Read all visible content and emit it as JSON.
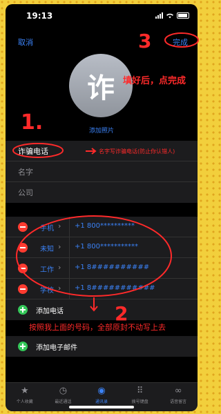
{
  "status": {
    "time": "19:13"
  },
  "nav": {
    "cancel": "取消",
    "done": "完成"
  },
  "avatar": {
    "initial": "诈",
    "add_photo": "添加照片"
  },
  "name_fields": [
    {
      "value": "诈骗电话",
      "placeholder": false
    },
    {
      "value": "名字",
      "placeholder": true
    },
    {
      "value": "公司",
      "placeholder": true
    }
  ],
  "phones": [
    {
      "type": "手机",
      "number": "+1 800**********"
    },
    {
      "type": "未知",
      "number": "+1 800***********"
    },
    {
      "type": "工作",
      "number": "+1 8##########"
    },
    {
      "type": "学校",
      "number": "+1 8###########"
    }
  ],
  "add_phone": "添加电话",
  "add_email": "添加电子邮件",
  "tabs": [
    {
      "label": "个人收藏",
      "icon": "star-icon",
      "glyph": "★",
      "active": false
    },
    {
      "label": "最近通话",
      "icon": "clock-icon",
      "glyph": "◷",
      "active": false
    },
    {
      "label": "通讯录",
      "icon": "person-icon",
      "glyph": "◉",
      "active": true
    },
    {
      "label": "拨号键盘",
      "icon": "keypad-icon",
      "glyph": "⠿",
      "active": false
    },
    {
      "label": "语音留言",
      "icon": "voicemail-icon",
      "glyph": "∞",
      "active": false
    }
  ],
  "annotations": {
    "step1": "1.",
    "step2": "2",
    "step3": "3",
    "note_done": "填好后，点完成",
    "note_name": "名字写诈骗电话(防止你认错人)",
    "note_copy": "按照我上面的号码，全部原封不动写上去"
  },
  "colors": {
    "accent": "#3b82f6",
    "annotation": "#ff2a2a",
    "delete": "#ff3b30",
    "add": "#34c759"
  }
}
